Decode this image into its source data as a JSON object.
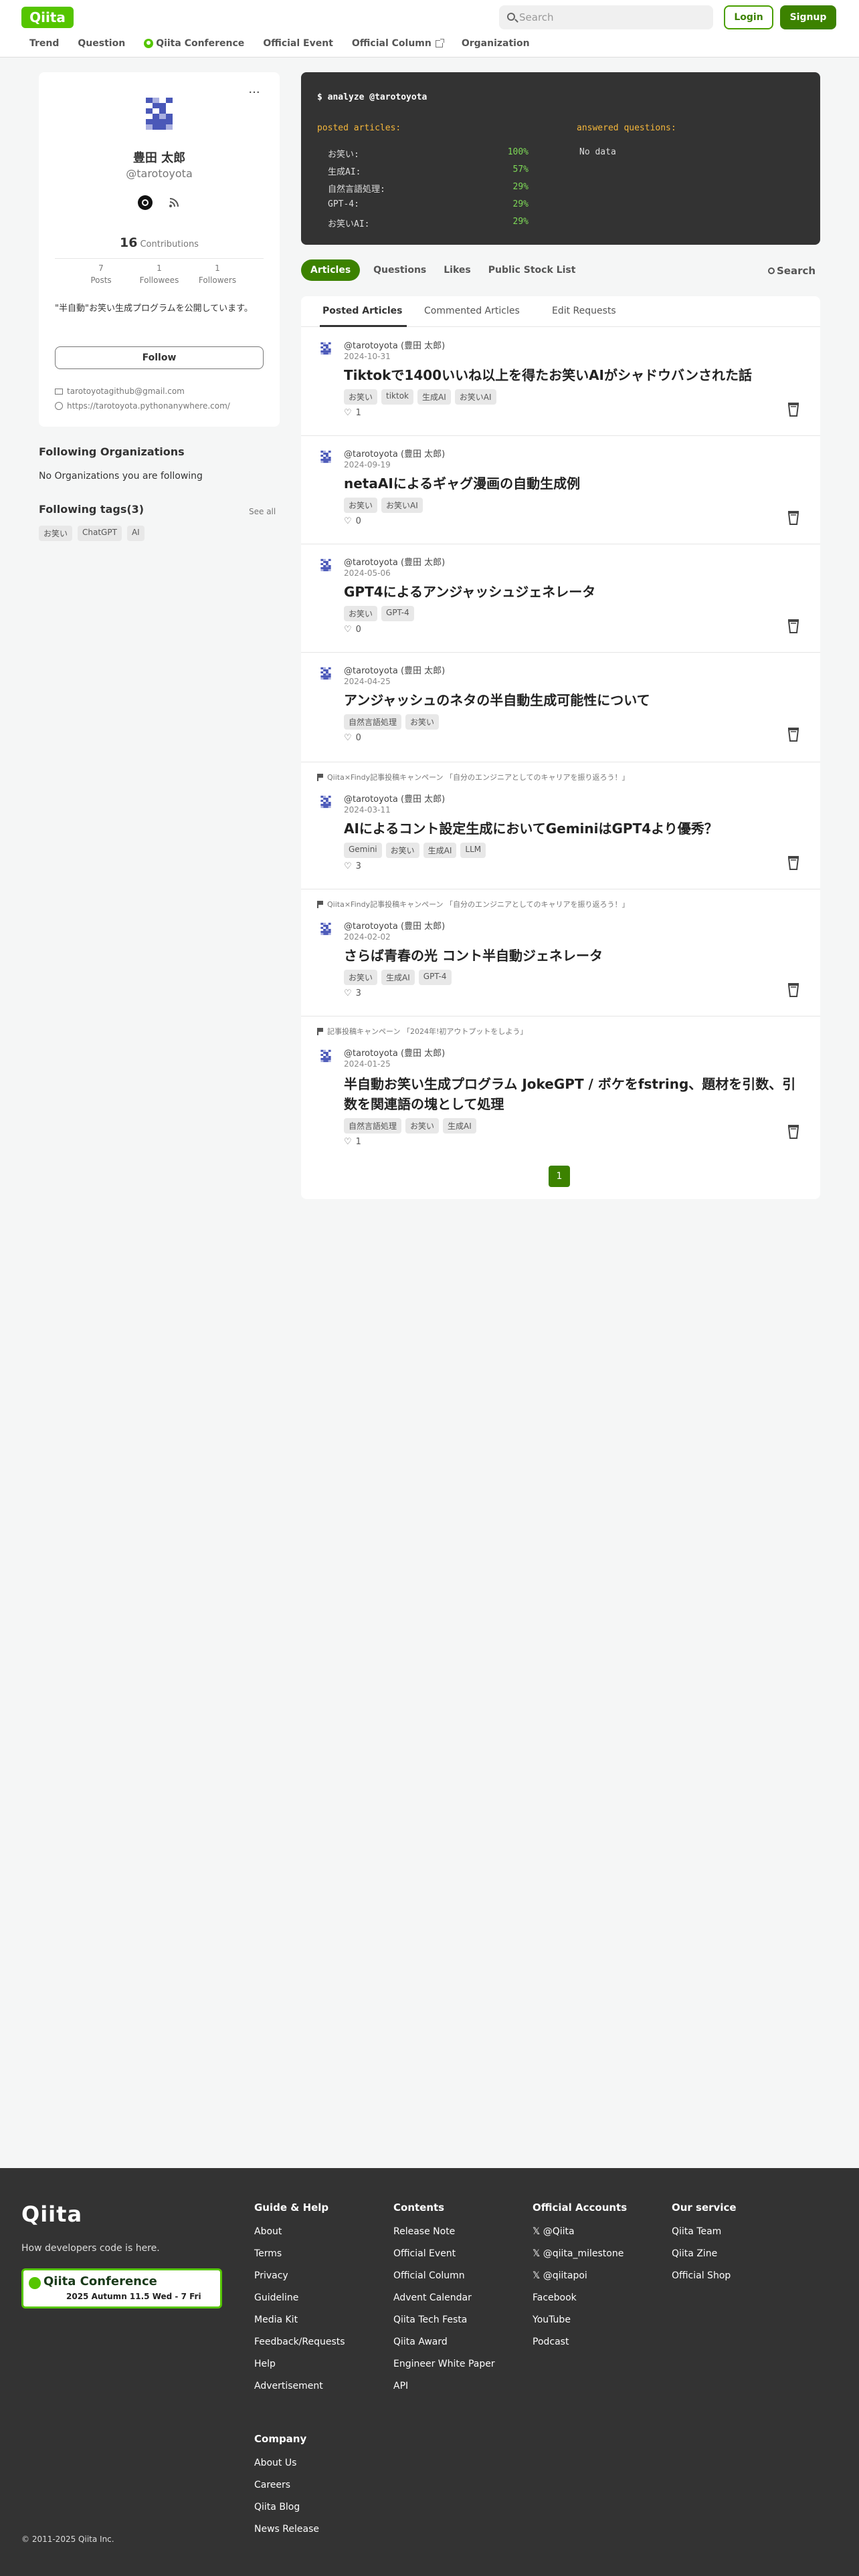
{
  "header": {
    "logo": "Qiita",
    "search_placeholder": "Search",
    "login": "Login",
    "signup": "Signup",
    "nav": [
      "Trend",
      "Question",
      "Qiita Conference",
      "Official Event",
      "Official Column",
      "Organization"
    ]
  },
  "profile": {
    "name": "豊田 太郎",
    "handle": "@tarotoyota",
    "contributions_count": "16",
    "contributions_label": "Contributions",
    "stats": [
      {
        "value": "7",
        "label": "Posts"
      },
      {
        "value": "1",
        "label": "Followees"
      },
      {
        "value": "1",
        "label": "Followers"
      }
    ],
    "description": "\"半自動\"お笑い生成プログラムを公開しています。",
    "follow": "Follow",
    "email": "tarotoyotagithub@gmail.com",
    "website": "https://tarotoyota.pythonanywhere.com/"
  },
  "following_orgs": {
    "title": "Following Organizations",
    "empty": "No Organizations you are following"
  },
  "following_tags": {
    "title": "Following tags(3)",
    "see_all": "See all",
    "tags": [
      "お笑い",
      "ChatGPT",
      "AI"
    ]
  },
  "terminal": {
    "command": "$ analyze @tarotoyota",
    "posted_header": "posted articles:",
    "answered_header": "answered questions:",
    "answered_value": "No data",
    "rows": [
      {
        "label": "お笑い:",
        "value": "100%"
      },
      {
        "label": "生成AI:",
        "value": "57%"
      },
      {
        "label": "自然言語処理:",
        "value": "29%"
      },
      {
        "label": "GPT-4:",
        "value": "29%"
      },
      {
        "label": "お笑いAI:",
        "value": "29%"
      }
    ]
  },
  "tabs": {
    "items": [
      "Articles",
      "Questions",
      "Likes",
      "Public Stock List"
    ],
    "search": "Search",
    "sub": [
      "Posted Articles",
      "Commented Articles",
      "Edit Requests"
    ]
  },
  "articles": [
    {
      "author": "@tarotoyota (豊田 太郎)",
      "date": "2024-10-31",
      "title": "Tiktokで1400いいね以上を得たお笑いAIがシャドウバンされた話",
      "tags": [
        "お笑い",
        "tiktok",
        "生成AI",
        "お笑いAI"
      ],
      "likes": "1"
    },
    {
      "author": "@tarotoyota (豊田 太郎)",
      "date": "2024-09-19",
      "title": "netaAIによるギャグ漫画の自動生成例",
      "tags": [
        "お笑い",
        "お笑いAI"
      ],
      "likes": "0"
    },
    {
      "author": "@tarotoyota (豊田 太郎)",
      "date": "2024-05-06",
      "title": "GPT4によるアンジャッシュジェネレータ",
      "tags": [
        "お笑い",
        "GPT-4"
      ],
      "likes": "0"
    },
    {
      "author": "@tarotoyota (豊田 太郎)",
      "date": "2024-04-25",
      "title": "アンジャッシュのネタの半自動生成可能性について",
      "tags": [
        "自然言語処理",
        "お笑い"
      ],
      "likes": "0"
    },
    {
      "campaign": "Qiita×Findy記事投稿キャンペーン 「自分のエンジニアとしてのキャリアを振り返ろう！」",
      "author": "@tarotoyota (豊田 太郎)",
      "date": "2024-03-11",
      "title": "AIによるコント設定生成においてGeminiはGPT4より優秀？",
      "tags": [
        "Gemini",
        "お笑い",
        "生成AI",
        "LLM"
      ],
      "likes": "3"
    },
    {
      "campaign": "Qiita×Findy記事投稿キャンペーン 「自分のエンジニアとしてのキャリアを振り返ろう！」",
      "author": "@tarotoyota (豊田 太郎)",
      "date": "2024-02-02",
      "title": "さらば青春の光 コント半自動ジェネレータ",
      "tags": [
        "お笑い",
        "生成AI",
        "GPT-4"
      ],
      "likes": "3"
    },
    {
      "campaign": "記事投稿キャンペーン 「2024年!初アウトプットをしよう」",
      "author": "@tarotoyota (豊田 太郎)",
      "date": "2024-01-25",
      "title": "半自動お笑い生成プログラム JokeGPT / ボケをfstring、題材を引数、引数を関連語の塊として処理",
      "tags": [
        "自然言語処理",
        "お笑い",
        "生成AI"
      ],
      "likes": "1"
    }
  ],
  "pagination": {
    "current": "1"
  },
  "footer": {
    "logo": "Qiita",
    "tagline": "How developers code is here.",
    "banner_title": "Qiita Conference",
    "banner_sub": "2025 Autumn 11.5 Wed - 7 Fri",
    "copyright": "© 2011-2025 Qiita Inc.",
    "columns": [
      {
        "title": "Guide & Help",
        "links": [
          "About",
          "Terms",
          "Privacy",
          "Guideline",
          "Media Kit",
          "Feedback/Requests",
          "Help",
          "Advertisement"
        ]
      },
      {
        "title": "Contents",
        "links": [
          "Release Note",
          "Official Event",
          "Official Column",
          "Advent Calendar",
          "Qiita Tech Festa",
          "Qiita Award",
          "Engineer White Paper",
          "API"
        ]
      },
      {
        "title": "Official Accounts",
        "links": [
          "@Qiita",
          "@qiita_milestone",
          "@qiitapoi",
          "Facebook",
          "YouTube",
          "Podcast"
        ]
      },
      {
        "title": "Our service",
        "links": [
          "Qiita Team",
          "Qiita Zine",
          "Official Shop"
        ]
      },
      {
        "title": "Company",
        "links": [
          "About Us",
          "Careers",
          "Qiita Blog",
          "News Release"
        ]
      }
    ]
  }
}
